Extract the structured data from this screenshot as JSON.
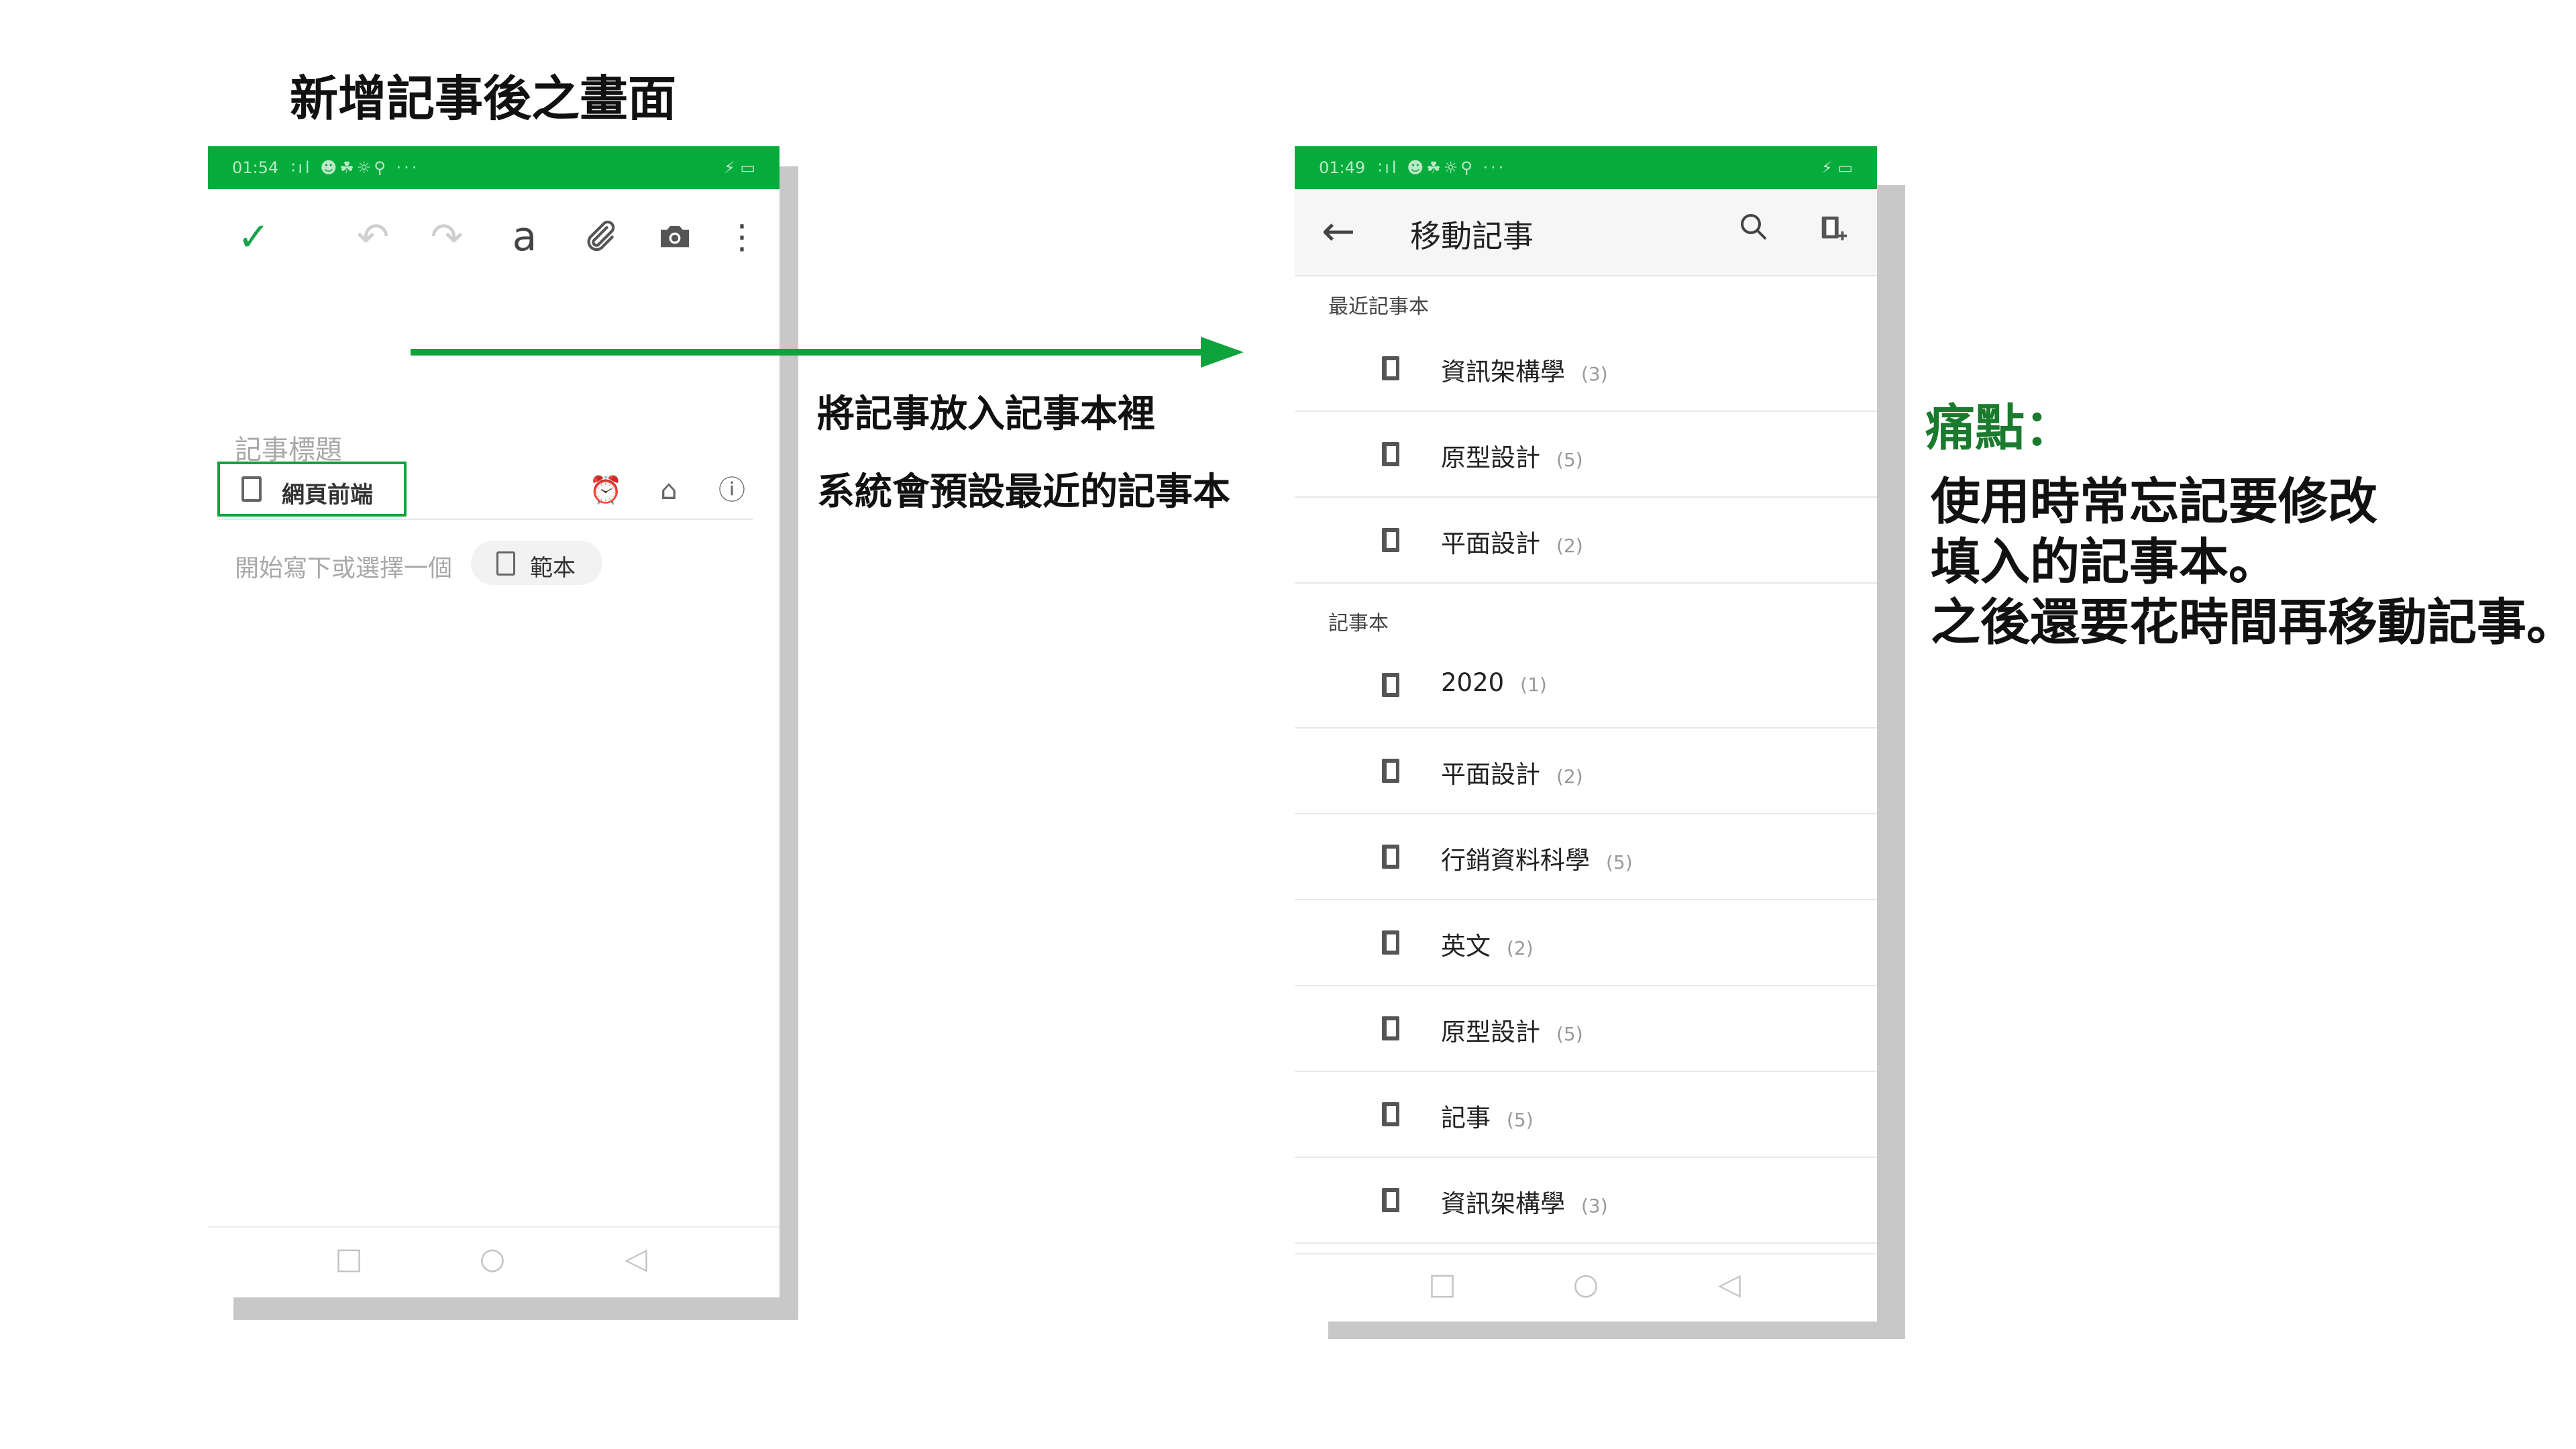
{
  "slide": {
    "title": "新增記事後之畫面",
    "caption_line1": "將記事放入記事本裡",
    "caption_line2": "系統會預設最近的記事本",
    "pain_title": "痛點：",
    "pain_lines": [
      "使用時常忘記要修改",
      "填入的記事本。",
      "之後還要花時間再移動記事。"
    ]
  },
  "colors": {
    "status_green": "#05ac3c",
    "highlight_green": "#0fa33c",
    "pain_green": "#1a7a2e"
  },
  "phone1": {
    "status_time": "01:54",
    "status_indicators": "∶ıl ☻☘☼⚲ ···",
    "status_right": "⚡ ▭",
    "toolbar_icons": [
      "check-icon",
      "undo-icon",
      "redo-icon",
      "text-format-icon",
      "attachment-icon",
      "camera-icon",
      "more-icon"
    ],
    "text_format_glyph": "a",
    "title_placeholder": "記事標題",
    "notebook_chip": "網頁前端",
    "body_placeholder": "開始寫下或選擇一個",
    "template_button": "範本"
  },
  "phone2": {
    "status_time": "01:49",
    "status_indicators": "∶ıl ☻☘☼⚲ ···",
    "status_right": "⚡ ▭",
    "title": "移動記事",
    "recent_header": "最近記事本",
    "recent": [
      {
        "name": "資訊架構學",
        "count": "(3)"
      },
      {
        "name": "原型設計",
        "count": "(5)"
      },
      {
        "name": "平面設計",
        "count": "(2)"
      }
    ],
    "all_header": "記事本",
    "notebooks": [
      {
        "name": "2020",
        "count": "(1)"
      },
      {
        "name": "平面設計",
        "count": "(2)"
      },
      {
        "name": "行銷資料科學",
        "count": "(5)"
      },
      {
        "name": "英文",
        "count": "(2)"
      },
      {
        "name": "原型設計",
        "count": "(5)"
      },
      {
        "name": "記事",
        "count": "(5)"
      },
      {
        "name": "資訊架構學",
        "count": "(3)"
      }
    ]
  }
}
